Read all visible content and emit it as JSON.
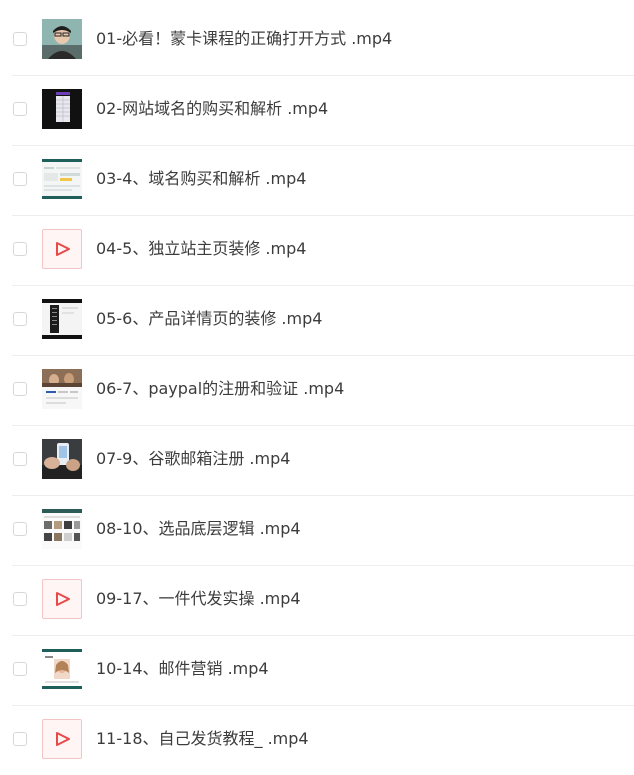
{
  "files": [
    {
      "name": "01-必看！蒙卡课程的正确打开方式 .mp4",
      "thumb": "person"
    },
    {
      "name": "02-网站域名的购买和解析 .mp4",
      "thumb": "dark-table"
    },
    {
      "name": "03-4、域名购买和解析 .mp4",
      "thumb": "webpage-teal"
    },
    {
      "name": "04-5、独立站主页装修 .mp4",
      "thumb": "play-icon"
    },
    {
      "name": "05-6、产品详情页的装修 .mp4",
      "thumb": "dark-panel"
    },
    {
      "name": "06-7、paypal的注册和验证 .mp4",
      "thumb": "photo-page"
    },
    {
      "name": "07-9、谷歌邮箱注册 .mp4",
      "thumb": "hands-phone"
    },
    {
      "name": "08-10、选品底层逻辑 .mp4",
      "thumb": "product-grid"
    },
    {
      "name": "09-17、一件代发实操 .mp4",
      "thumb": "play-icon"
    },
    {
      "name": "10-14、邮件营销 .mp4",
      "thumb": "email-portrait"
    },
    {
      "name": "11-18、自己发货教程_ .mp4",
      "thumb": "play-icon"
    }
  ],
  "colors": {
    "play_accent": "#e84a4a",
    "text": "#3c3c3c",
    "divider": "#eeeeee"
  }
}
